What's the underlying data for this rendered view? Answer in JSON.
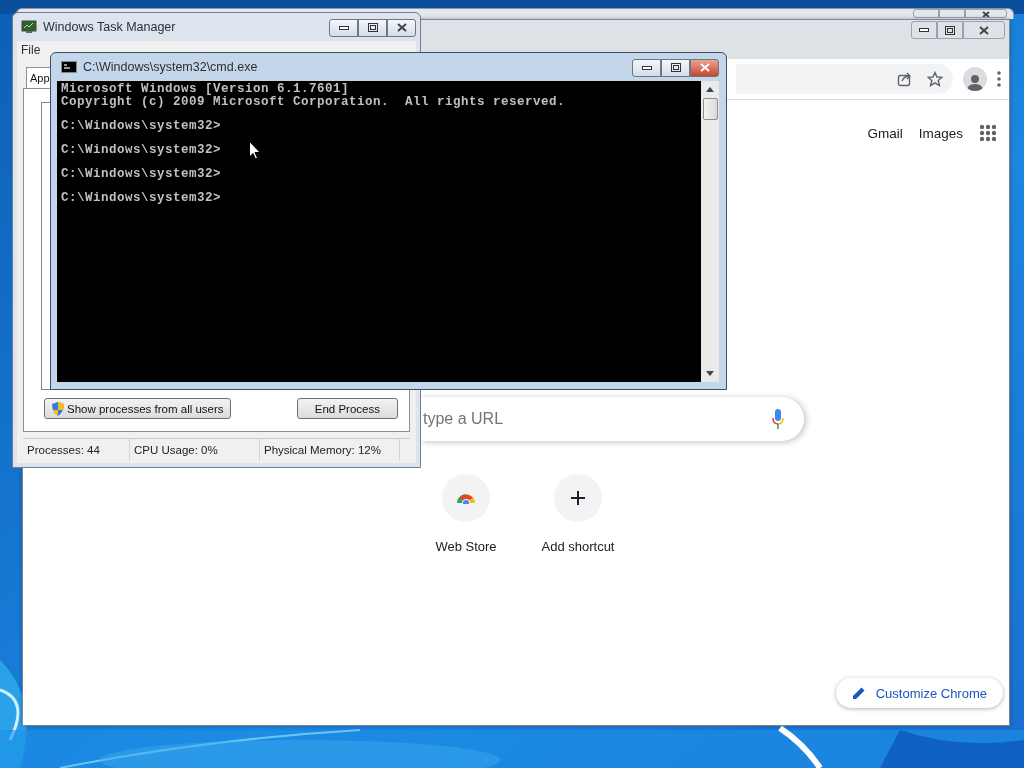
{
  "chrome_window": {
    "header_links": [
      "Gmail",
      "Images"
    ],
    "search": {
      "placeholder": "type a URL"
    },
    "shortcuts": [
      {
        "label": "Web Store",
        "kind": "store"
      },
      {
        "label": "Add shortcut",
        "kind": "add"
      }
    ],
    "customize_button": "Customize Chrome"
  },
  "task_manager": {
    "title": "Windows Task Manager",
    "menu": [
      "File"
    ],
    "tabs": [
      {
        "label": "App",
        "selected": true
      }
    ],
    "buttons": [
      {
        "label": "Show processes from all users",
        "kind": "shield"
      },
      {
        "label": "End Process",
        "kind": "plain"
      }
    ],
    "status_bar": [
      "Processes: 44",
      "CPU Usage: 0%",
      "Physical Memory: 12%"
    ]
  },
  "cmd_window": {
    "title": "C:\\Windows\\system32\\cmd.exe",
    "lines": [
      {
        "text": "Microsoft Windows [Version 6.1.7601]",
        "kind": "banner"
      },
      {
        "text": "Copyright (c) 2009 Microsoft Corporation.  All rights reserved.",
        "kind": "banner"
      },
      {
        "text": "C:\\Windows\\system32>",
        "kind": "prompt"
      },
      {
        "text": "C:\\Windows\\system32>",
        "kind": "prompt"
      },
      {
        "text": "C:\\Windows\\system32>",
        "kind": "prompt"
      },
      {
        "text": "C:\\Windows\\system32>",
        "kind": "prompt"
      }
    ]
  }
}
